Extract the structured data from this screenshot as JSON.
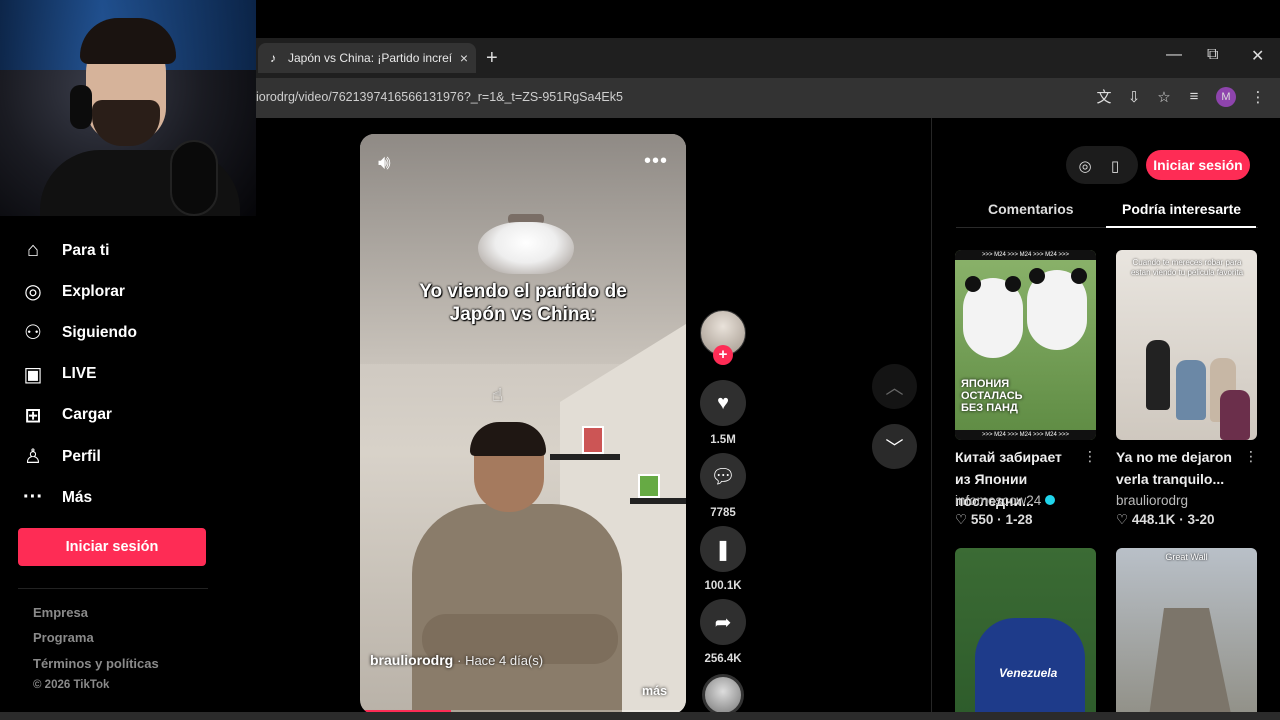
{
  "browser": {
    "tab_title": "Japón vs China: ¡Partido increíb",
    "tab_close": "×",
    "new_tab": "+",
    "url": "iorodrg/video/7621397416566131976?_r=1&_t=ZS-951RgSa4Ek5",
    "profile_initial": "M",
    "window_minimize": "—",
    "window_restore": "⧉",
    "window_close": "✕"
  },
  "sidebar": {
    "items": [
      {
        "label": "Para ti",
        "icon": "home-icon"
      },
      {
        "label": "Explorar",
        "icon": "compass-icon"
      },
      {
        "label": "Siguiendo",
        "icon": "user-follow-icon"
      },
      {
        "label": "LIVE",
        "icon": "live-tv-icon"
      },
      {
        "label": "Cargar",
        "icon": "upload-icon"
      },
      {
        "label": "Perfil",
        "icon": "profile-icon"
      },
      {
        "label": "Más",
        "icon": "more-icon"
      }
    ],
    "login_label": "Iniciar sesión",
    "footer": [
      "Empresa",
      "Programa",
      "Términos y políticas",
      "© 2026 TikTok"
    ]
  },
  "video": {
    "caption_line1": "Yo viendo el partido de",
    "caption_line2": "Japón vs China:",
    "author": "brauliorodrg",
    "date": "· Hace 4 día(s)",
    "more": "más",
    "progress": 0.28
  },
  "actions": {
    "likes": "1.5M",
    "comments": "7785",
    "saves": "100.1K",
    "shares": "256.4K"
  },
  "panel": {
    "login_label": "Iniciar sesión",
    "tabs": [
      "Comentarios",
      "Podría interesarte"
    ],
    "active_tab": "Podría interesarte",
    "cards": [
      {
        "title": "Китай забирает из Японии последни...",
        "author": "infomoscow24",
        "verified": true,
        "likes": "550",
        "date": "1-28",
        "thumb_text": "ЯПОНИЯ ОСТАЛАСЬ БЕЗ ПАНД",
        "thumb_strip": ">>> M24 >>> M24 >>> M24 >>>"
      },
      {
        "title": "Ya no me dejaron verla tranquilo...",
        "author": "brauliorodrg",
        "verified": false,
        "likes": "448.1K",
        "date": "3-20",
        "thumb_text": "Cuando te mereces robar para estan viendo tu pelicula favorita"
      },
      {
        "thumb_text": "Venezuela"
      },
      {
        "thumb_text": "Great Wall"
      }
    ]
  }
}
